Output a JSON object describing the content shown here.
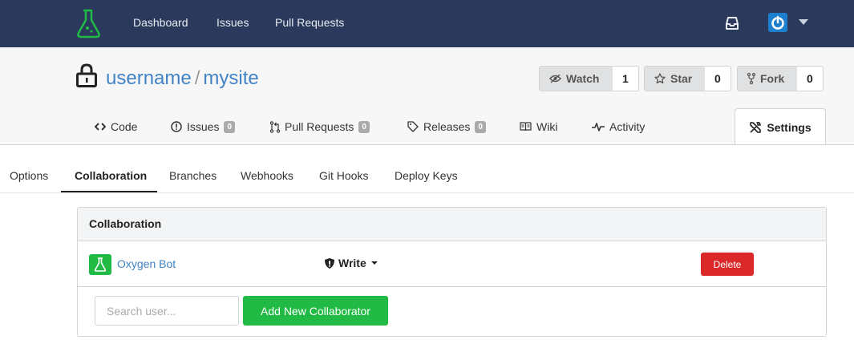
{
  "colors": {
    "navbar": "#2b3a5c",
    "link": "#4183c4",
    "primary_green": "#21ba45",
    "danger": "#db2828"
  },
  "navbar": {
    "logo_icon": "flask-logo-icon",
    "links": [
      "Dashboard",
      "Issues",
      "Pull Requests"
    ],
    "inbox_icon": "inbox-icon",
    "avatar_icon": "power-avatar-icon"
  },
  "repo": {
    "owner": "username",
    "separator": "/",
    "name": "mysite",
    "buttons": {
      "watch": {
        "label": "Watch",
        "count": "1",
        "icon": "eye-icon"
      },
      "star": {
        "label": "Star",
        "count": "0",
        "icon": "star-icon"
      },
      "fork": {
        "label": "Fork",
        "count": "0",
        "icon": "fork-icon"
      }
    }
  },
  "tabs": {
    "code": {
      "label": "Code"
    },
    "issues": {
      "label": "Issues",
      "count": "0"
    },
    "pulls": {
      "label": "Pull Requests",
      "count": "0"
    },
    "releases": {
      "label": "Releases",
      "count": "0"
    },
    "wiki": {
      "label": "Wiki"
    },
    "activity": {
      "label": "Activity"
    },
    "settings": {
      "label": "Settings"
    }
  },
  "settings_tabs": {
    "options": "Options",
    "collaboration": "Collaboration",
    "branches": "Branches",
    "webhooks": "Webhooks",
    "git_hooks": "Git Hooks",
    "deploy_keys": "Deploy Keys"
  },
  "panel": {
    "title": "Collaboration",
    "collaborator": {
      "name": "Oxygen Bot",
      "permission": "Write",
      "delete_label": "Delete"
    },
    "search_placeholder": "Search user...",
    "add_label": "Add New Collaborator"
  }
}
